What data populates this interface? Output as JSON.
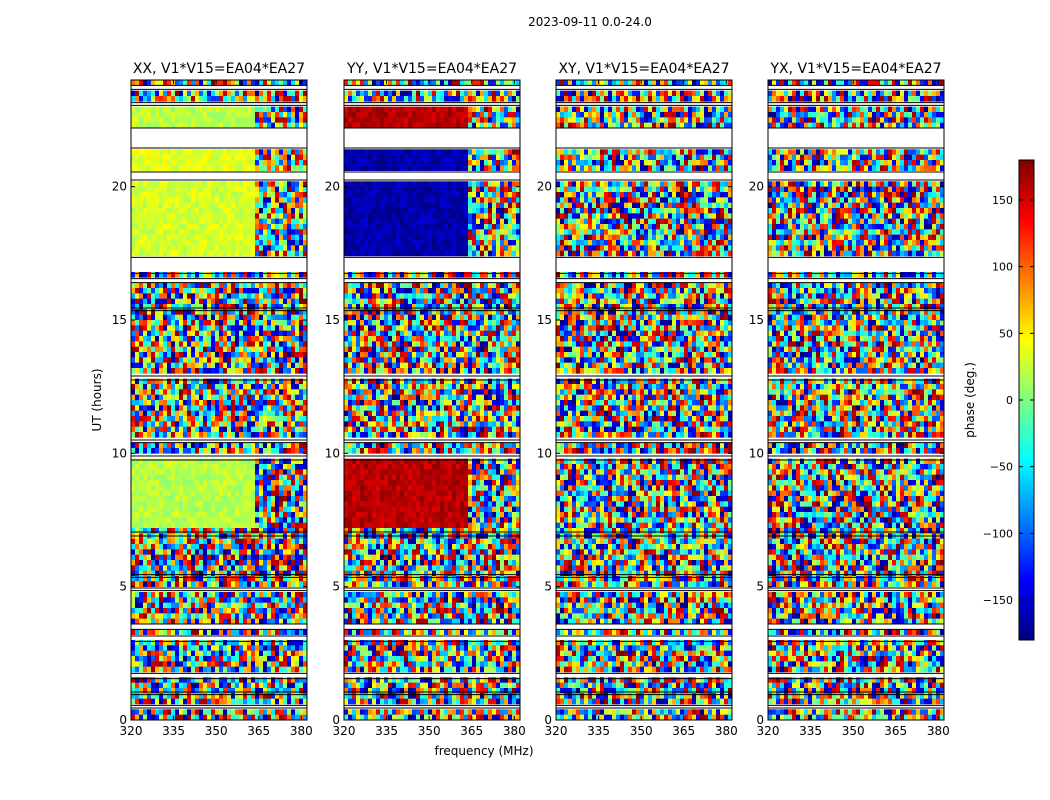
{
  "figure": {
    "suptitle": "2023-09-11 0.0-24.0",
    "xlabel": "frequency (MHz)",
    "ylabel": "UT (hours)",
    "colorbar_label": "phase (deg.)",
    "colorbar_ticks": [
      150,
      100,
      50,
      0,
      -50,
      -100,
      -150
    ],
    "colorbar_range": [
      -180,
      180
    ],
    "colormap": "jet",
    "colormap_stops": [
      "#00007f",
      "#0000ff",
      "#007fff",
      "#00ffff",
      "#7fff7f",
      "#ffff00",
      "#ff7f00",
      "#ff0000",
      "#7f0000"
    ]
  },
  "chart_data": [
    {
      "type": "heatmap",
      "title": "XX, V1*V15=EA04*EA27",
      "xlim": [
        320,
        382
      ],
      "ylim": [
        0,
        24
      ],
      "x_ticks": [
        320,
        335,
        350,
        365,
        380
      ],
      "y_ticks": [
        0,
        5,
        10,
        15,
        20
      ],
      "coherent_regions": [
        {
          "ut": [
            7.3,
            9.7
          ],
          "freq": [
            320,
            363
          ],
          "phase_deg": 20
        },
        {
          "ut": [
            17.5,
            20.2
          ],
          "freq": [
            320,
            363
          ],
          "phase_deg": 30
        },
        {
          "ut": [
            20.6,
            21.4
          ],
          "freq": [
            320,
            363
          ],
          "phase_deg": 35
        },
        {
          "ut": [
            22.3,
            23.0
          ],
          "freq": [
            320,
            363
          ],
          "phase_deg": 20
        }
      ]
    },
    {
      "type": "heatmap",
      "title": "YY, V1*V15=EA04*EA27",
      "xlim": [
        320,
        382
      ],
      "ylim": [
        0,
        24
      ],
      "x_ticks": [
        320,
        335,
        350,
        365,
        380
      ],
      "y_ticks": [
        0,
        5,
        10,
        15,
        20
      ],
      "coherent_regions": [
        {
          "ut": [
            7.3,
            9.7
          ],
          "freq": [
            320,
            363
          ],
          "phase_deg": 160
        },
        {
          "ut": [
            17.5,
            20.2
          ],
          "freq": [
            320,
            363
          ],
          "phase_deg": -165
        },
        {
          "ut": [
            20.6,
            21.4
          ],
          "freq": [
            320,
            363
          ],
          "phase_deg": -165
        },
        {
          "ut": [
            22.3,
            23.0
          ],
          "freq": [
            320,
            363
          ],
          "phase_deg": 160
        }
      ]
    },
    {
      "type": "heatmap",
      "title": "XY, V1*V15=EA04*EA27",
      "xlim": [
        320,
        382
      ],
      "ylim": [
        0,
        24
      ],
      "x_ticks": [
        320,
        335,
        350,
        365,
        380
      ],
      "y_ticks": [
        0,
        5,
        10,
        15,
        20
      ],
      "coherent_regions": []
    },
    {
      "type": "heatmap",
      "title": "YX, V1*V15=EA04*EA27",
      "xlim": [
        320,
        382
      ],
      "ylim": [
        0,
        24
      ],
      "x_ticks": [
        320,
        335,
        350,
        365,
        380
      ],
      "y_ticks": [
        0,
        5,
        10,
        15,
        20
      ],
      "coherent_regions": []
    }
  ],
  "data_gaps_ut": [
    [
      0.45,
      0.55
    ],
    [
      0.95,
      1.05
    ],
    [
      1.55,
      1.75
    ],
    [
      2.95,
      3.15
    ],
    [
      3.4,
      3.6
    ],
    [
      4.85,
      4.95
    ],
    [
      5.35,
      5.45
    ],
    [
      6.9,
      7.05
    ],
    [
      9.75,
      9.9
    ],
    [
      10.4,
      10.5
    ],
    [
      12.75,
      12.9
    ],
    [
      15.35,
      15.45
    ],
    [
      16.4,
      16.55
    ],
    [
      16.75,
      17.35
    ],
    [
      20.25,
      20.55
    ],
    [
      21.45,
      22.2
    ],
    [
      23.05,
      23.15
    ],
    [
      23.65,
      23.8
    ]
  ]
}
